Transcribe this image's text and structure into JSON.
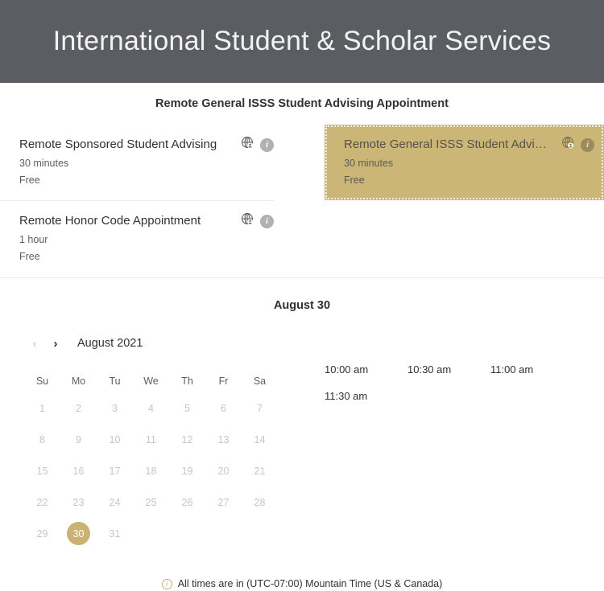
{
  "banner": {
    "title": "International Student & Scholar Services",
    "background_color": "#5a5d62",
    "text_color": "#f3f2f1"
  },
  "theme": {
    "accent_color": "#cbb577",
    "selected_day_color": "#c9b272",
    "divider_color": "#edebe9"
  },
  "service_section": {
    "heading": "Remote General ISSS Student Advising Appointment",
    "items": [
      {
        "name": "Remote Sponsored Student Advising",
        "duration": "30 minutes",
        "price": "Free",
        "globe_icon": "globe-user-icon",
        "info_icon": "info-circle-icon",
        "selected": false,
        "column": "left"
      },
      {
        "name": "Remote Honor Code Appointment",
        "duration": "1 hour",
        "price": "Free",
        "globe_icon": "globe-user-icon",
        "info_icon": "info-circle-icon",
        "selected": false,
        "column": "left"
      },
      {
        "name": "Remote General ISSS Student Advising...",
        "duration": "30 minutes",
        "price": "Free",
        "globe_icon": "globe-user-icon",
        "info_icon": "info-circle-icon",
        "selected": true,
        "column": "right"
      }
    ]
  },
  "scheduler": {
    "selected_date_heading": "August 30",
    "calendar": {
      "prev_label": "‹",
      "next_label": "›",
      "month_label": "August 2021",
      "day_headers": [
        "Su",
        "Mo",
        "Tu",
        "We",
        "Th",
        "Fr",
        "Sa"
      ],
      "leading_blanks": 0,
      "days": [
        1,
        2,
        3,
        4,
        5,
        6,
        7,
        8,
        9,
        10,
        11,
        12,
        13,
        14,
        15,
        16,
        17,
        18,
        19,
        20,
        21,
        22,
        23,
        24,
        25,
        26,
        27,
        28,
        29,
        30,
        31
      ],
      "selected_day": 30
    },
    "time_slots": [
      "10:00 am",
      "10:30 am",
      "11:00 am",
      "11:30 am"
    ]
  },
  "footer": {
    "icon": "info-circle-icon",
    "timezone_note": "All times are in (UTC-07:00) Mountain Time (US & Canada)"
  }
}
